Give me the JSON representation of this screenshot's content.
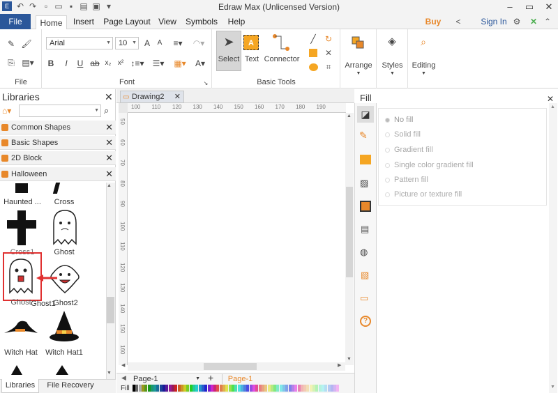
{
  "app": {
    "title": "Edraw Max (Unlicensed Version)"
  },
  "menu": {
    "file": "File",
    "items": [
      "Home",
      "Insert",
      "Page Layout",
      "View",
      "Symbols",
      "Help"
    ],
    "buy_now": "Buy Now",
    "sign_in": "Sign In"
  },
  "ribbon": {
    "file_group": "File",
    "font": {
      "family": "Arial",
      "size": "10",
      "group_label": "Font"
    },
    "tools": {
      "select": "Select",
      "text": "Text",
      "connector": "Connector",
      "group_label": "Basic Tools"
    },
    "arrange": "Arrange",
    "styles": "Styles",
    "editing": "Editing"
  },
  "libraries": {
    "title": "Libraries",
    "categories": [
      "Common Shapes",
      "Basic Shapes",
      "2D Block",
      "Halloween"
    ],
    "shapes": [
      "Haunted ...",
      "Cross",
      "Cross1",
      "Ghost",
      "Ghost",
      "Ghost1",
      "Ghost2",
      "Witch Hat",
      "Witch Hat1"
    ]
  },
  "document": {
    "tab": "Drawing2",
    "ruler_h": [
      "100",
      "110",
      "120",
      "130",
      "140",
      "150",
      "160",
      "170",
      "180",
      "190"
    ],
    "ruler_v": [
      "50",
      "60",
      "70",
      "80",
      "90",
      "100",
      "110",
      "120",
      "130",
      "140",
      "150",
      "160"
    ]
  },
  "bottom": {
    "libraries_tab": "Libraries",
    "recovery_tab": "File Recovery",
    "page_select": "Page-1",
    "page_tab": "Page-1",
    "fill_label": "Fill"
  },
  "fill_panel": {
    "title": "Fill",
    "options": [
      "No fill",
      "Solid fill",
      "Gradient fill",
      "Single color gradient fill",
      "Pattern fill",
      "Picture or texture fill"
    ]
  },
  "colors": {
    "accent": "#2b579a",
    "buy_now": "#e8882a",
    "highlight": "#e03030"
  }
}
